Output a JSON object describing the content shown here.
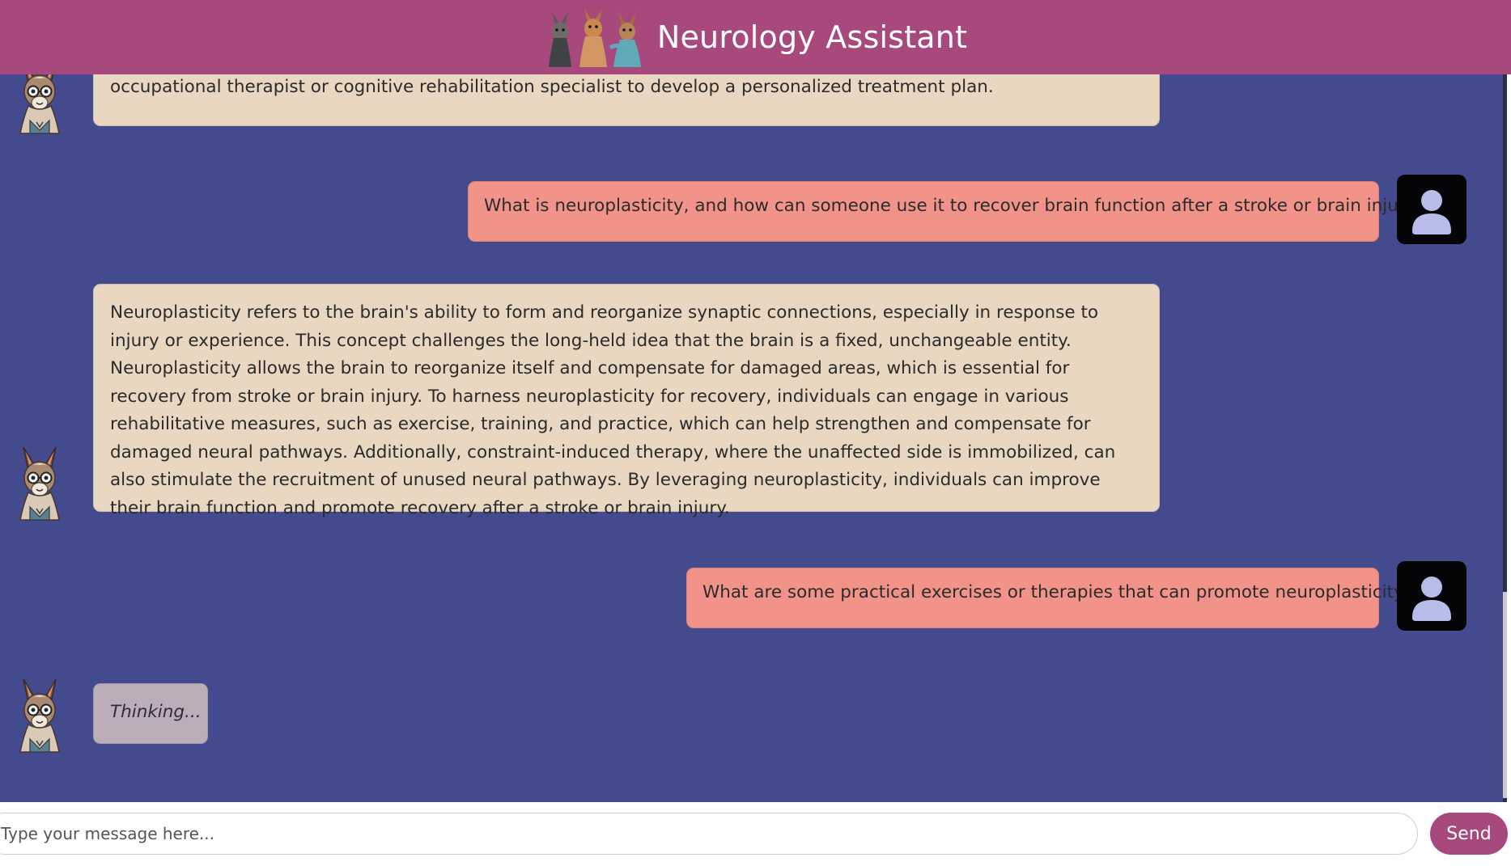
{
  "header": {
    "title": "Neurology Assistant",
    "logo_icon": "llama-trio-logo"
  },
  "messages": [
    {
      "role": "assistant",
      "avatar": "llama-doctor-avatar",
      "text": "improvement in their symptoms, usually within the first several weeks, and may benefit from working with an occupational therapist or cognitive rehabilitation specialist to develop a personalized treatment plan."
    },
    {
      "role": "user",
      "avatar": "user-silhouette-avatar",
      "text": "What is neuroplasticity, and how can someone use it to recover brain function after a stroke or brain injury?"
    },
    {
      "role": "assistant",
      "avatar": "llama-doctor-avatar",
      "text": "Neuroplasticity refers to the brain's ability to form and reorganize synaptic connections, especially in response to injury or experience. This concept challenges the long-held idea that the brain is a fixed, unchangeable entity. Neuroplasticity allows the brain to reorganize itself and compensate for damaged areas, which is essential for recovery from stroke or brain injury. To harness neuroplasticity for recovery, individuals can engage in various rehabilitative measures, such as exercise, training, and practice, which can help strengthen and compensate for damaged neural pathways. Additionally, constraint-induced therapy, where the unaffected side is immobilized, can also stimulate the recruitment of unused neural pathways. By leveraging neuroplasticity, individuals can improve their brain function and promote recovery after a stroke or brain injury."
    },
    {
      "role": "user",
      "avatar": "user-silhouette-avatar",
      "text": "What are some practical exercises or therapies that can promote neuroplasticity?"
    },
    {
      "role": "assistant",
      "avatar": "llama-doctor-avatar",
      "text": "Thinking..."
    }
  ],
  "input": {
    "placeholder": "Type your message here...",
    "value": ""
  },
  "send_label": "Send",
  "colors": {
    "header": "#a7497d",
    "chat_background": "#434a8e",
    "assistant_bubble": "#e9d7c2",
    "user_bubble": "#f2938a",
    "thinking_bubble": "#bcaeb9",
    "send_button": "#a7497d"
  }
}
